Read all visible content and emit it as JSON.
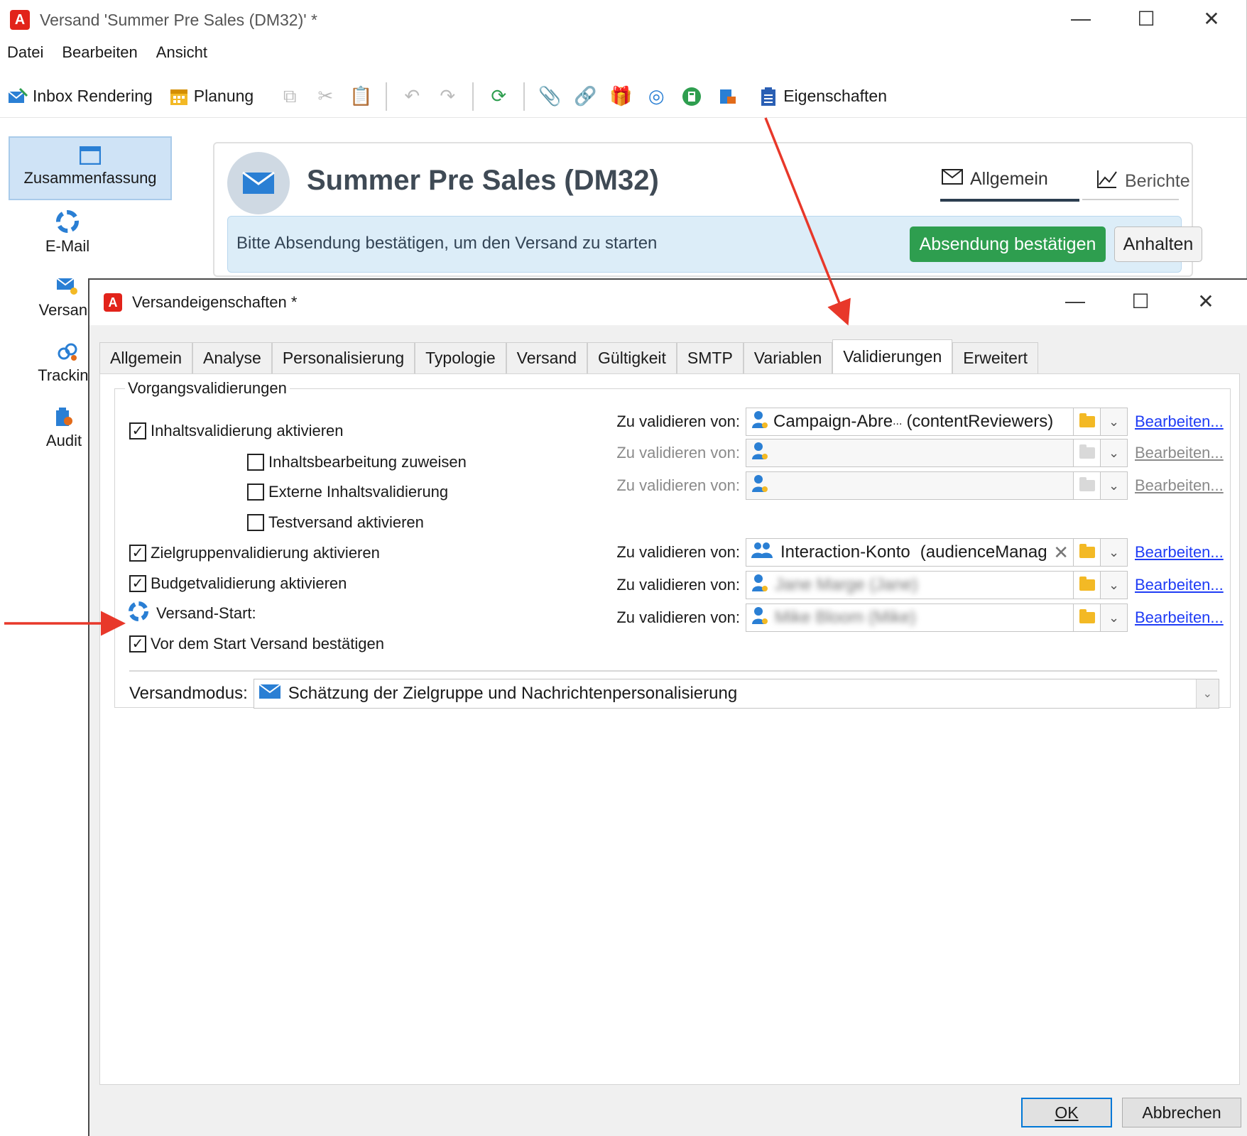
{
  "main_window": {
    "title": "Versand  'Summer Pre Sales (DM32)' *",
    "controls": {
      "minimize": "—",
      "maximize": "☐",
      "close": "✕"
    },
    "menu": [
      "Datei",
      "Bearbeiten",
      "Ansicht"
    ],
    "toolbar": {
      "inbox_rendering": "Inbox Rendering",
      "planung": "Planung",
      "eigenschaften": "Eigenschaften"
    },
    "sidebar": {
      "items": [
        {
          "label": "Zusammenfassung",
          "icon": "summary-icon",
          "active": true
        },
        {
          "label": "E-Mail",
          "icon": "email-icon"
        },
        {
          "label": "Versand",
          "icon": "delivery-icon"
        },
        {
          "label": "Tracking",
          "icon": "tracking-icon"
        },
        {
          "label": "Audit",
          "icon": "audit-icon"
        }
      ]
    },
    "summary": {
      "title": "Summer Pre Sales (DM32)",
      "tabs": {
        "general": "Allgemein",
        "reports": "Berichte"
      },
      "banner_text": "Bitte Absendung bestätigen, um den Versand zu starten",
      "confirm_button": "Absendung bestätigen",
      "pause_button": "Anhalten"
    }
  },
  "dialog": {
    "title": "Versandeigenschaften *",
    "tabs": [
      "Allgemein",
      "Analyse",
      "Personalisierung",
      "Typologie",
      "Versand",
      "Gültigkeit",
      "SMTP",
      "Variablen",
      "Validierungen",
      "Erweitert"
    ],
    "active_tab": "Validierungen",
    "group_title": "Vorgangsvalidierungen",
    "checkboxes": {
      "content_validation": {
        "label": "Inhaltsvalidierung aktivieren",
        "checked": true
      },
      "assign_editing": {
        "label": "Inhaltsbearbeitung zuweisen",
        "checked": false
      },
      "external_validation": {
        "label": "Externe Inhaltsvalidierung",
        "checked": false
      },
      "proof_send": {
        "label": "Testversand aktivieren",
        "checked": false
      },
      "target_validation": {
        "label": "Zielgruppenvalidierung aktivieren",
        "checked": true
      },
      "budget_validation": {
        "label": "Budgetvalidierung aktivieren",
        "checked": true
      },
      "delivery_start": {
        "label": "Versand-Start:"
      },
      "confirm_before_start": {
        "label": "Vor dem Start Versand bestätigen",
        "checked": true
      }
    },
    "validators": {
      "label": "Zu validieren von:",
      "edit_link": "Bearbeiten...",
      "row1": {
        "name": "Campaign-Abre",
        "ellipsis": "...",
        "group": "(contentReviewers)"
      },
      "row4": {
        "name": "Interaction-Konto",
        "group": "(audienceManag"
      },
      "row5": {
        "name": "Jane Marge (Jane)"
      },
      "row6": {
        "name": "Mike Bloom (Mike)"
      }
    },
    "mode": {
      "label": "Versandmodus:",
      "value": "Schätzung der Zielgruppe und Nachrichtenpersonalisierung"
    },
    "buttons": {
      "ok": "OK",
      "cancel": "Abbrechen"
    }
  },
  "colors": {
    "accent_red": "#e2231a",
    "confirm_green": "#2e9e4f",
    "banner_bg": "#dcedf8",
    "link_blue": "#1f3cf5",
    "annotation_arrow": "#e8382a"
  }
}
